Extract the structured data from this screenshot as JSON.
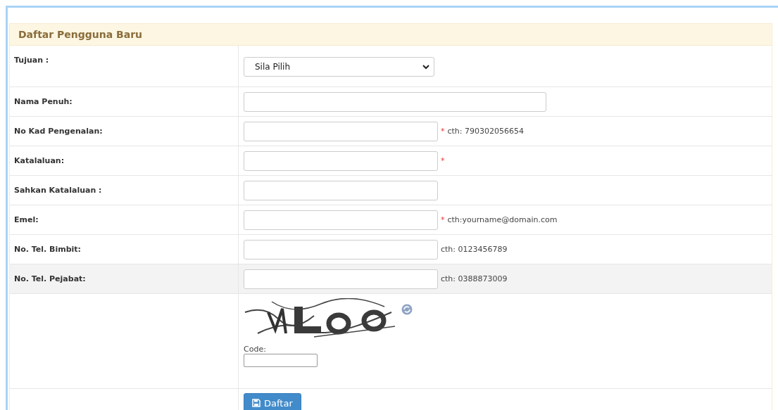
{
  "panel": {
    "title": "Daftar Pengguna Baru"
  },
  "rows": [
    {
      "label": "Tujuan :",
      "kind": "select",
      "value": "Sila Pilih",
      "highlighted": false
    },
    {
      "label": "Nama Penuh:",
      "kind": "long-text",
      "highlighted": false
    },
    {
      "label": "No Kad Pengenalan:",
      "kind": "text",
      "marker": "*",
      "hint": "cth: 790302056654",
      "highlighted": false
    },
    {
      "label": "Katalaluan:",
      "kind": "text",
      "marker": "*",
      "highlighted": false
    },
    {
      "label": "Sahkan Katalaluan :",
      "kind": "text",
      "highlighted": false
    },
    {
      "label": "Emel:",
      "kind": "text",
      "marker": "*",
      "hint": "cth:yourname@domain.com",
      "highlighted": false
    },
    {
      "label": "No. Tel. Bimbit:",
      "kind": "text",
      "hint": "cth: 0123456789",
      "highlighted": false
    },
    {
      "label": "No. Tel. Pejabat:",
      "kind": "text",
      "hint": "cth: 0388873009",
      "highlighted": true
    }
  ],
  "captcha": {
    "code_label": "Code:"
  },
  "submit": {
    "label": "Daftar"
  }
}
